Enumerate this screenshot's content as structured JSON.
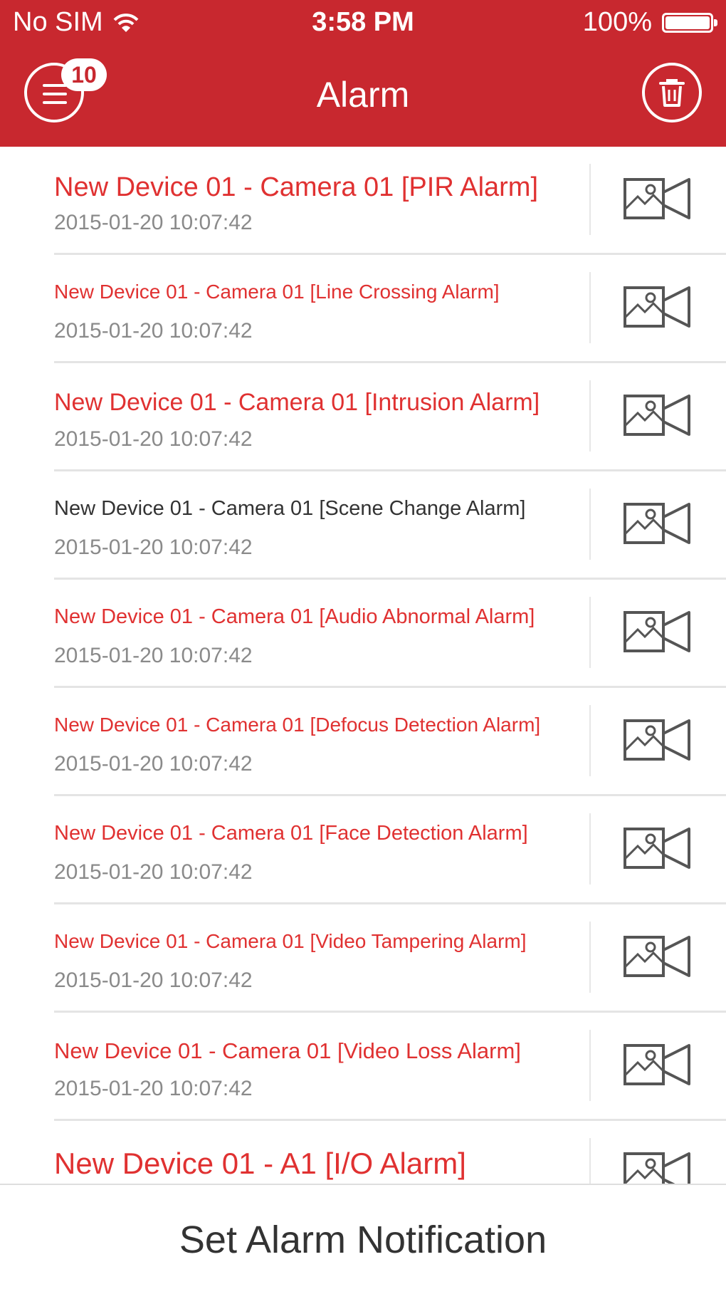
{
  "status_bar": {
    "carrier": "No SIM",
    "time": "3:58 PM",
    "battery": "100%",
    "battery_level": 1.0
  },
  "nav": {
    "title": "Alarm",
    "badge_count": "10"
  },
  "alarms": [
    {
      "title": "New Device 01 - Camera 01 [PIR Alarm]",
      "time": "2015-01-20 10:07:42"
    },
    {
      "title": "New Device 01 - Camera 01 [Line Crossing Alarm]",
      "time": "2015-01-20 10:07:42"
    },
    {
      "title": "New Device 01 - Camera 01 [Intrusion Alarm]",
      "time": "2015-01-20 10:07:42"
    },
    {
      "title": "New Device 01 - Camera 01 [Scene Change Alarm]",
      "time": "2015-01-20 10:07:42"
    },
    {
      "title": "New Device 01 - Camera 01 [Audio Abnormal Alarm]",
      "time": "2015-01-20 10:07:42"
    },
    {
      "title": "New Device 01 - Camera 01 [Defocus Detection Alarm]",
      "time": "2015-01-20 10:07:42"
    },
    {
      "title": "New Device 01 - Camera 01 [Face Detection Alarm]",
      "time": "2015-01-20 10:07:42"
    },
    {
      "title": "New Device 01 - Camera 01 [Video Tampering Alarm]",
      "time": "2015-01-20 10:07:42"
    },
    {
      "title": "New Device 01 - Camera 01 [Video Loss Alarm]",
      "time": "2015-01-20 10:07:42"
    },
    {
      "title": "New Device 01 - A1 [I/O Alarm]",
      "time": ""
    }
  ],
  "footer": {
    "label": "Set Alarm Notification"
  },
  "colors": {
    "brand": "#c8282f",
    "unread": "#e03131",
    "read": "#333333",
    "timestamp": "#8a8a8a"
  },
  "icons": {
    "menu": "menu-icon",
    "delete": "trash-icon",
    "video": "video-playback-icon",
    "wifi": "wifi-icon",
    "battery": "battery-icon"
  }
}
